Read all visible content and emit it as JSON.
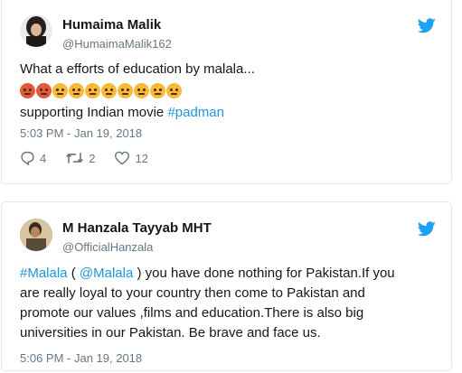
{
  "tweet1": {
    "name": "Humaima Malik",
    "handle": "@HumaimaMalik162",
    "line1": "What a efforts  of education by malala...",
    "line3_text": "supporting Indian movie ",
    "line3_tag": "#padman",
    "emoji_faces": [
      "pouting-face",
      "pouting-face",
      "face-with-steam",
      "angry-face",
      "angry-face",
      "angry-face",
      "face-with-steam",
      "face-with-steam",
      "face-with-steam",
      "face-with-steam"
    ],
    "timestamp": "5:03 PM - Jan 19, 2018",
    "replies": "4",
    "retweets": "2",
    "likes": "12"
  },
  "tweet2": {
    "name": "M Hanzala Tayyab MHT",
    "handle": "@OfficialHanzala",
    "tag": "#Malala",
    "paren_open": " ( ",
    "mention": "@Malala",
    "body_line1_rest": " ) you have done nothing for Pakistan.If you",
    "body_line2": "are really loyal to your country then come to Pakistan and",
    "body_line3": "promote our values ,films and education.There is also big",
    "body_line4": "universities in our Pakistan. Be brave and face us.",
    "timestamp": "5:06 PM - Jan 19, 2018"
  },
  "colors": {
    "link": "#1b95e0",
    "muted": "#657786",
    "twitter_blue": "#1da1f2"
  },
  "icons": [
    "twitter-bird-icon",
    "reply-icon",
    "retweet-icon",
    "like-icon"
  ]
}
